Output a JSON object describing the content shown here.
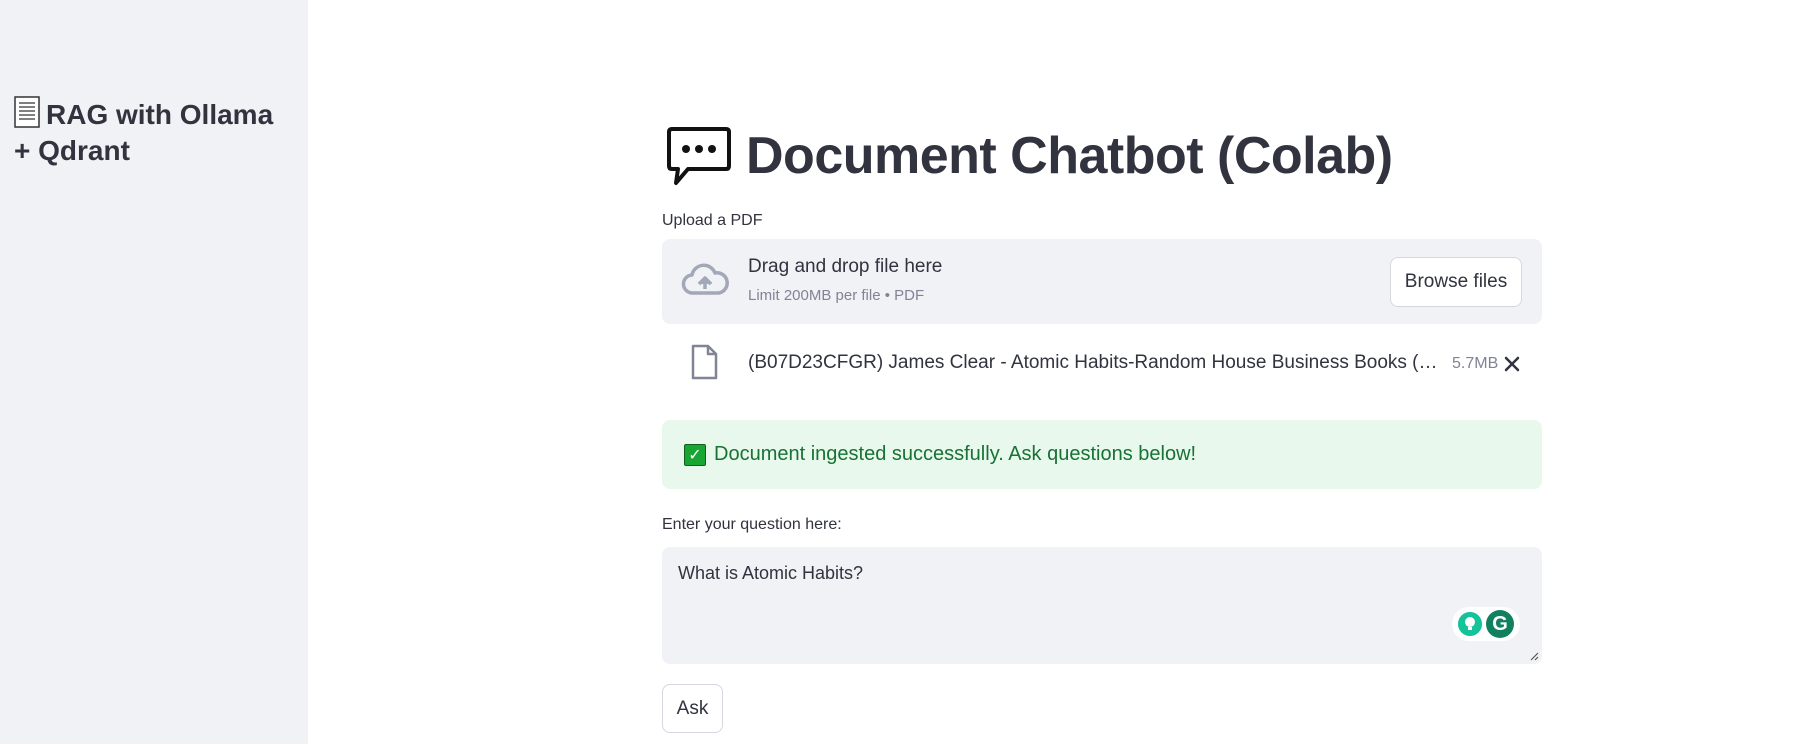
{
  "sidebar": {
    "title": "RAG with Ollama + Qdrant",
    "title_icon": "page-icon"
  },
  "main": {
    "title": "Document Chatbot (Colab)",
    "title_icon": "speech-bubble-icon",
    "uploader": {
      "label": "Upload a PDF",
      "drop_text": "Drag and drop file here",
      "limit_text": "Limit 200MB per file • PDF",
      "browse_label": "Browse files",
      "file": {
        "name": "(B07D23CFGR) James Clear - Atomic Habits-Random House Business Books (2018…",
        "size": "5.7MB"
      }
    },
    "success_message": "Document ingested successfully. Ask questions below!",
    "question": {
      "label": "Enter your question here:",
      "value": "What is Atomic Habits?"
    },
    "ask_label": "Ask"
  },
  "colors": {
    "sidebar_bg": "#f0f2f6",
    "text": "#31333f",
    "muted": "#808495",
    "success_bg": "#e8f8ed",
    "success_text": "#177233"
  }
}
